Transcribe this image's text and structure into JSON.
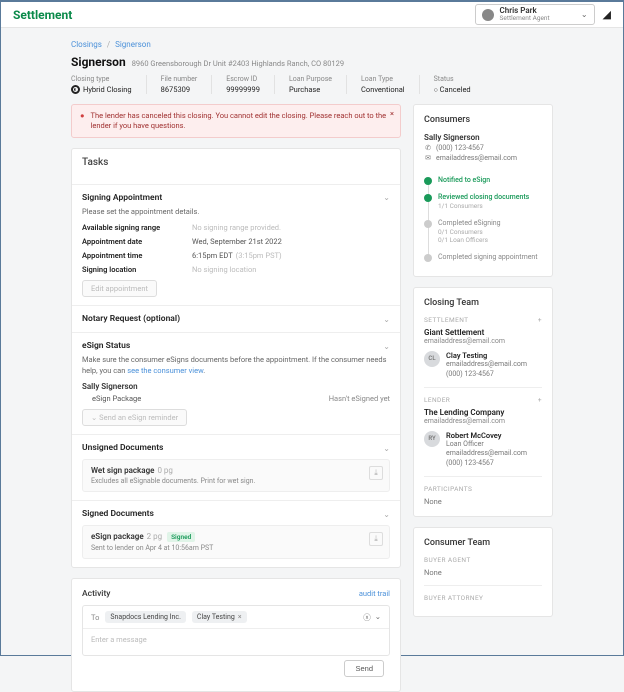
{
  "brand": "Settlement",
  "user": {
    "name": "Chris Park",
    "role": "Settlement Agent"
  },
  "breadcrumbs": {
    "a": "Closings",
    "b": "Signerson"
  },
  "closing": {
    "name": "Signerson",
    "address": "8960 Greensborough Dr Unit #2403 Highlands Ranch, CO 80129",
    "meta": {
      "closing_type_lbl": "Closing type",
      "closing_type": "Hybrid Closing",
      "file_number_lbl": "File number",
      "file_number": "8675309",
      "escrow_id_lbl": "Escrow ID",
      "escrow_id": "99999999",
      "loan_purpose_lbl": "Loan Purpose",
      "loan_purpose": "Purchase",
      "loan_type_lbl": "Loan Type",
      "loan_type": "Conventional",
      "status_lbl": "Status",
      "status": "Canceled"
    }
  },
  "alert": "The lender has canceled this closing. You cannot edit the closing. Please reach out to the lender if you have questions.",
  "tasks": {
    "heading": "Tasks",
    "signing": {
      "title": "Signing Appointment",
      "intro": "Please set the appointment details.",
      "range_lbl": "Available signing range",
      "range_val": "No signing range provided.",
      "date_lbl": "Appointment date",
      "date_val": "Wed, September 21st 2022",
      "time_lbl": "Appointment time",
      "time_val": "6:15pm EDT",
      "time_sub": "(3:15pm PST)",
      "loc_lbl": "Signing location",
      "loc_val": "No signing location",
      "edit_btn": "Edit appointment"
    },
    "notary": {
      "title": "Notary Request (optional)"
    },
    "esign": {
      "title": "eSign Status",
      "desc1": "Make sure the consumer eSigns documents before the appointment. If the consumer needs help, you can ",
      "desc_link": "see the consumer view",
      "signer": "Sally Signerson",
      "pkg": "eSign Package",
      "pkg_status": "Hasn't eSigned yet",
      "remind_btn": "Send an eSign reminder"
    },
    "unsigned": {
      "title": "Unsigned Documents",
      "doc_name": "Wet sign package",
      "doc_cnt": "0 pg",
      "doc_sub": "Excludes all eSignable documents. Print for wet sign."
    },
    "signed": {
      "title": "Signed Documents",
      "doc_name": "eSign package",
      "doc_cnt": "2 pg",
      "badge": "Signed",
      "doc_sub": "Sent to lender on Apr 4 at 10:56am PST"
    }
  },
  "activity": {
    "title": "Activity",
    "audit": "audit trail",
    "to_lbl": "To",
    "chips": [
      "Snapdocs Lending Inc.",
      "Clay Testing"
    ],
    "placeholder": "Enter a message",
    "send": "Send"
  },
  "consumers": {
    "heading": "Consumers",
    "name": "Sally Signerson",
    "phone": "(000) 123-4567",
    "email": "emailaddress@email.com",
    "timeline": [
      {
        "title": "Notified to eSign",
        "sub": "",
        "done": true
      },
      {
        "title": "Reviewed closing documents",
        "sub": "1/1 Consumers",
        "done": true
      },
      {
        "title": "Completed eSigning",
        "sub": "0/1 Consumers\n0/1 Loan Officers",
        "done": false
      },
      {
        "title": "Completed signing appointment",
        "sub": "",
        "done": false
      }
    ]
  },
  "closing_team": {
    "heading": "Closing Team",
    "settlement_lbl": "SETTLEMENT",
    "settlement_co": "Giant Settlement",
    "settlement_em": "emailaddress@email.com",
    "settlement_person": {
      "initials": "CL",
      "name": "Clay Testing",
      "email": "emailaddress@email.com",
      "phone": "(000) 123-4567"
    },
    "lender_lbl": "LENDER",
    "lender_co": "The Lending Company",
    "lender_em": "emailaddress@email.com",
    "lender_person": {
      "initials": "RY",
      "name": "Robert McCovey",
      "role": "Loan Officer",
      "email": "emailaddress@email.com",
      "phone": "(000) 123-4567"
    },
    "participants_lbl": "PARTICIPANTS",
    "participants_none": "None"
  },
  "consumer_team": {
    "heading": "Consumer Team",
    "buyer_agent_lbl": "BUYER AGENT",
    "buyer_agent_none": "None",
    "buyer_attorney_lbl": "BUYER ATTORNEY"
  }
}
